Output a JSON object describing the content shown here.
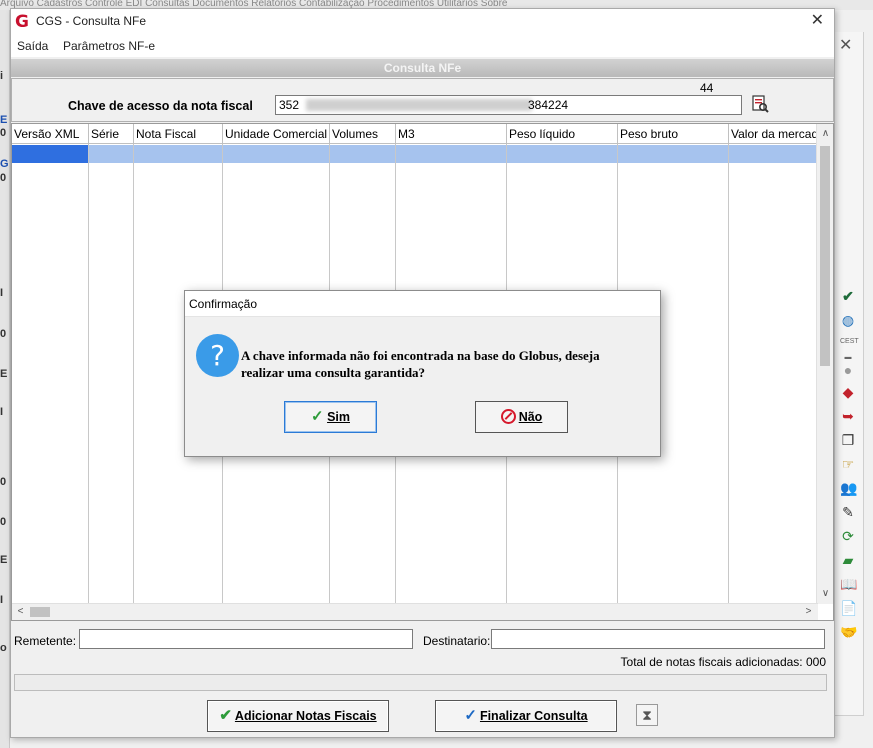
{
  "background": {
    "top_strip_text": "Arquivo   Cadastros   Controle   EDI   Consultas   Documentos   Relatórios   Contabilização   Procedimentos   Utilitários   Sobre",
    "left_letters": [
      "i",
      "E",
      "0",
      "G",
      "0",
      "I",
      "0",
      "E",
      "I",
      "0",
      "0",
      "E",
      "I",
      "o"
    ]
  },
  "window": {
    "title": "CGS - Consulta NFe",
    "logo": "G",
    "close_glyph": "✕",
    "menu": [
      "Saída",
      "Parâmetros NF-e"
    ],
    "form_caption": "Consulta NFe"
  },
  "key": {
    "label": "Chave de acesso da nota fiscal",
    "value_start": "352",
    "value_end": "384224",
    "count": "44",
    "search_icon": "search-document-icon"
  },
  "grid": {
    "columns": [
      "Versão XML",
      "Série",
      "Nota Fiscal",
      "Unidade Comercial",
      "Volumes",
      "M3",
      "Peso líquido",
      "Peso bruto",
      "Valor da mercado"
    ],
    "scroll_up": "∧",
    "scroll_down": "∨",
    "scroll_left": "<",
    "scroll_right": ">"
  },
  "footer": {
    "remetente_label": "Remetente:",
    "destinatario_label": "Destinatario:",
    "total_label": "Total de notas fiscais adicionadas: 000",
    "add_button": "Adicionar Notas Fiscais",
    "finish_button": "Finalizar Consulta",
    "hourglass_icon": "hourglass-icon"
  },
  "dialog": {
    "title": "Confirmação",
    "message_line1": "A chave informada não foi encontrada na base do Globus, deseja",
    "message_line2": "realizar uma consulta garantida?",
    "yes_label": "Sim",
    "no_label": "Não",
    "icon": "question-icon"
  },
  "side_toolbar": [
    "check-icon",
    "globe-icon",
    "cest-icon",
    "circle-icon",
    "eraser-icon",
    "export-icon",
    "copy-icon",
    "pointer-icon",
    "people-icon",
    "edit-icon",
    "refresh-icon",
    "car-icon",
    "book-icon",
    "document-icon",
    "handshake-icon"
  ],
  "colors": {
    "selection_dark": "#2f6fe0",
    "selection_light": "#a6c3ee",
    "question_blue": "#3a9be8",
    "no_red": "#d6192c",
    "check_green": "#2e9c3a",
    "logo_red": "#c8102e"
  }
}
